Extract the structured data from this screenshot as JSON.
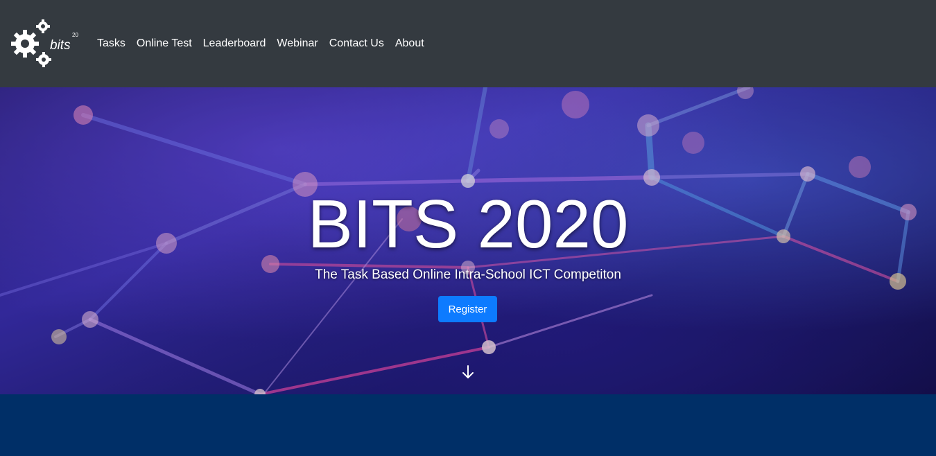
{
  "brand": {
    "logo_icon": "gears-logo-icon",
    "logo_text": "bits",
    "logo_year": "20"
  },
  "nav": {
    "items": [
      {
        "label": "Tasks"
      },
      {
        "label": "Online Test"
      },
      {
        "label": "Leaderboard"
      },
      {
        "label": "Webinar"
      },
      {
        "label": "Contact Us"
      },
      {
        "label": "About"
      }
    ]
  },
  "hero": {
    "title": "BITS 2020",
    "subtitle": "The Task Based Online Intra-School ICT Competiton",
    "register_label": "Register",
    "scroll_icon": "arrow-down-icon"
  },
  "colors": {
    "navbar_bg": "#343a40",
    "button_bg": "#0d7bff",
    "band_bg": "#002f67"
  }
}
